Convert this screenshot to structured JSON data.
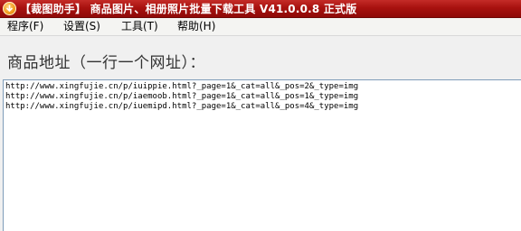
{
  "window": {
    "title": "【裁图助手】 商品图片、相册照片批量下载工具 V41.0.0.8 正式版",
    "title_color": "#a8120f"
  },
  "menu": {
    "items": [
      {
        "label": "程序(F)"
      },
      {
        "label": "设置(S)"
      },
      {
        "label": "工具(T)"
      },
      {
        "label": "帮助(H)"
      }
    ]
  },
  "main": {
    "url_label": "商品地址（一行一个网址）：",
    "urls": [
      "http://www.xingfujie.cn/p/iuippie.html?_page=1&_cat=all&_pos=2&_type=img",
      "http://www.xingfujie.cn/p/iaemoob.html?_page=1&_cat=all&_pos=1&_type=img",
      "http://www.xingfujie.cn/p/iuemipd.html?_page=1&_cat=all&_pos=4&_type=img"
    ]
  }
}
